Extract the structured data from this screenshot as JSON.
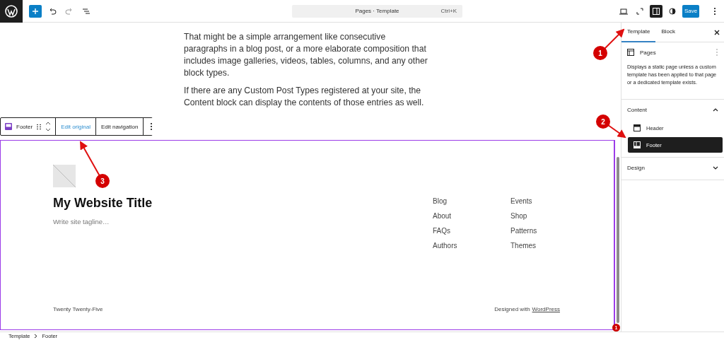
{
  "topbar": {
    "command": {
      "title": "Pages · Template",
      "shortcut": "Ctrl+K"
    },
    "sidebar_toggle": {
      "selected": true
    },
    "save": "Save"
  },
  "canvas": {
    "paragraphs": [
      "That might be a simple arrangement like consecutive paragraphs in a blog post, or a more elaborate composition that includes image galleries, videos, tables, columns, and any other block types.",
      "If there are any Custom Post Types registered at your site, the Content block can display the contents of those entries as well."
    ],
    "block_toolbar": {
      "block": "Footer",
      "buttons": [
        {
          "label": "Edit original",
          "highlighted": true
        },
        {
          "label": "Edit navigation",
          "highlighted": false
        }
      ]
    },
    "footer": {
      "site_title": "My Website Title",
      "tagline": "Write site tagline…",
      "nav_columns": [
        [
          "Blog",
          "About",
          "FAQs",
          "Authors"
        ],
        [
          "Events",
          "Shop",
          "Patterns",
          "Themes"
        ]
      ],
      "credit": "Twenty Twenty-Five",
      "designed_with": "Designed with",
      "link": "WordPress"
    },
    "badge": "1"
  },
  "sidebar": {
    "tabs": [
      {
        "label": "Template",
        "selected": true
      },
      {
        "label": "Block",
        "selected": false
      }
    ],
    "template": {
      "name": "Pages",
      "description": "Displays a static page unless a custom template has been applied to that page or a dedicated template exists."
    },
    "sections": [
      {
        "title": "Content",
        "expanded": true,
        "items": [
          {
            "label": "Header",
            "selected": false
          },
          {
            "label": "Footer",
            "selected": true
          }
        ]
      },
      {
        "title": "Design",
        "expanded": false
      }
    ]
  },
  "breadcrumb": [
    "Template",
    "Footer"
  ],
  "annotations": [
    {
      "label": "1"
    },
    {
      "label": "2"
    },
    {
      "label": "3"
    }
  ]
}
